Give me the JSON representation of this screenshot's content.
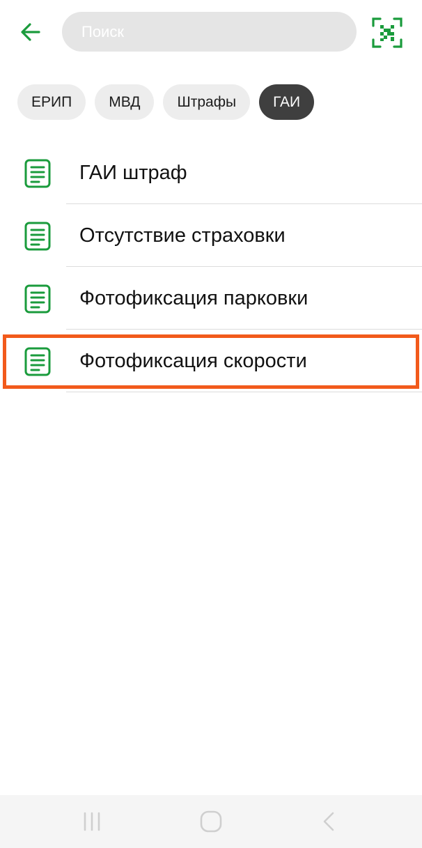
{
  "search": {
    "placeholder": "Поиск",
    "value": ""
  },
  "chips": [
    {
      "label": "ЕРИП",
      "active": false
    },
    {
      "label": "МВД",
      "active": false
    },
    {
      "label": "Штрафы",
      "active": false
    },
    {
      "label": "ГАИ",
      "active": true
    }
  ],
  "list": [
    {
      "label": "ГАИ штраф",
      "icon": "document-icon"
    },
    {
      "label": "Отсутствие страховки",
      "icon": "document-icon"
    },
    {
      "label": "Фотофиксация парковки",
      "icon": "document-icon"
    },
    {
      "label": "Фотофиксация скорости",
      "icon": "document-icon",
      "highlighted": true
    }
  ],
  "colors": {
    "accent": "#1a9b3c",
    "chip_bg": "#ededed",
    "chip_active_bg": "#3f3f3f",
    "highlight": "#f25a1b",
    "search_bg": "#e5e5e5"
  },
  "icons": {
    "back": "back-arrow-icon",
    "scan": "qr-scan-icon",
    "nav_recent": "recent-apps-icon",
    "nav_home": "home-icon",
    "nav_back": "nav-back-icon"
  }
}
